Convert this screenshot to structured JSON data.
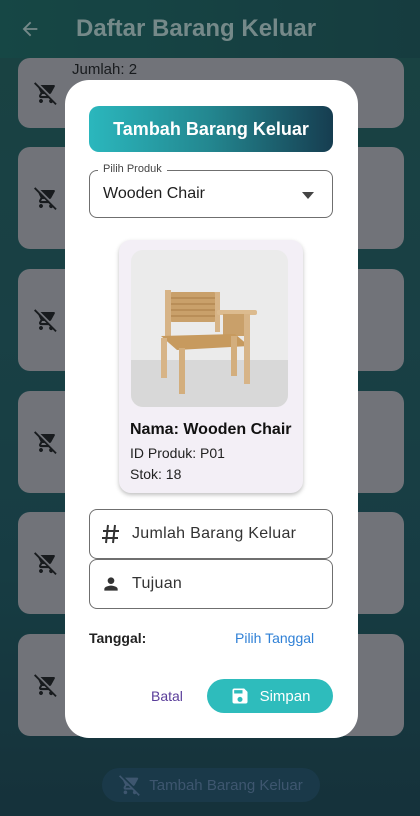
{
  "appbar": {
    "title": "Daftar Barang Keluar",
    "back_icon": "arrow-back-icon"
  },
  "background_list": {
    "first_item_text": "Jumlah: 2",
    "item_icon": "remove-shopping-cart-icon"
  },
  "fab": {
    "label": "Tambah Barang Keluar",
    "icon": "remove-shopping-cart-icon"
  },
  "dialog": {
    "title": "Tambah Barang Keluar",
    "product_select": {
      "label": "Pilih Produk",
      "value": "Wooden Chair"
    },
    "product_card": {
      "name": "Nama: Wooden Chair",
      "id": "ID Produk: P01",
      "stock": "Stok: 18"
    },
    "quantity_field": {
      "placeholder": "Jumlah Barang Keluar",
      "icon": "hash-icon"
    },
    "destination_field": {
      "placeholder": "Tujuan",
      "icon": "person-icon"
    },
    "date": {
      "label": "Tanggal:",
      "link": "Pilih Tanggal"
    },
    "actions": {
      "cancel": "Batal",
      "save": "Simpan",
      "save_icon": "save-icon"
    }
  },
  "colors": {
    "accent": "#2ebcbc",
    "link": "#2f80d6",
    "cancel_text": "#5a3d9a"
  }
}
